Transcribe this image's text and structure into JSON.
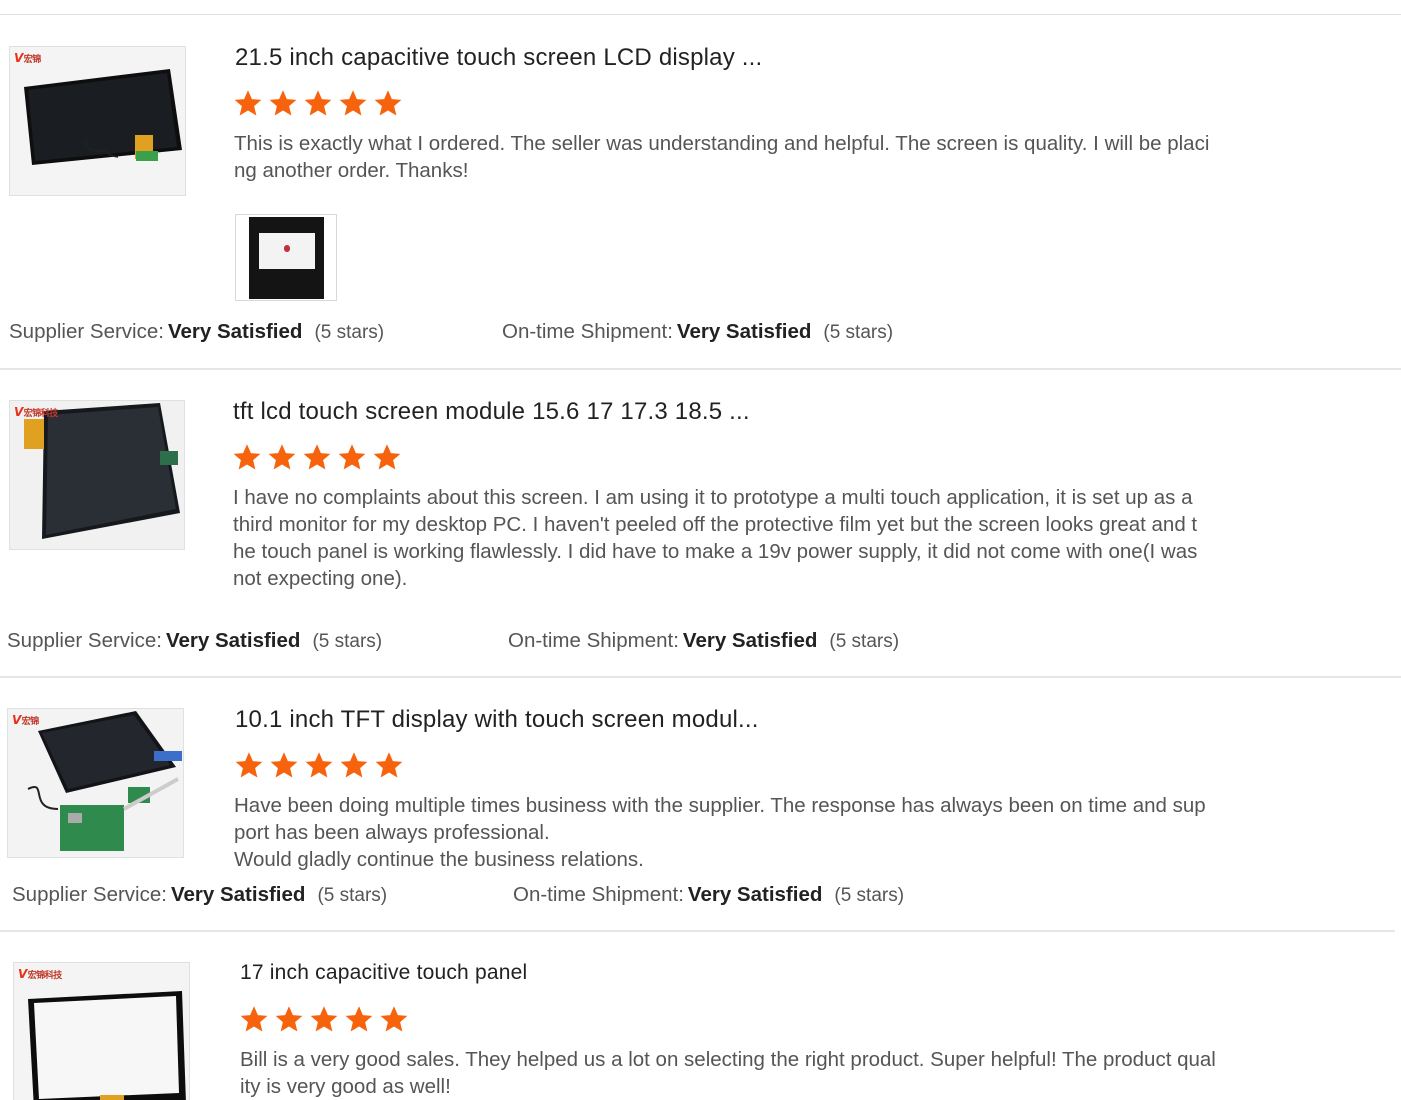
{
  "colors": {
    "star": "#f7630c",
    "divider": "#e6e6e6"
  },
  "reviews": [
    {
      "title": "21.5 inch capacitive touch screen LCD display ...",
      "rating": 5,
      "comment_lines": [
        "This is exactly what I ordered. The seller was understanding and helpful. The screen is quality. I will be placi",
        "ng another order. Thanks!"
      ],
      "supplier_label": "Supplier Service:",
      "supplier_value": "Very Satisfied",
      "supplier_count": "(5 stars)",
      "shipment_label": "On-time Shipment:",
      "shipment_value": "Very Satisfied",
      "shipment_count": "(5 stars)",
      "thumb_icon": "lcd-display-product-image"
    },
    {
      "title": "tft lcd touch screen module 15.6 17 17.3 18.5 ...",
      "rating": 5,
      "comment_lines": [
        "I have no complaints about this screen. I am using it to prototype a multi touch application, it is set up as a",
        "third monitor for my desktop PC. I haven't peeled off the protective film yet but the screen looks great and t",
        "he touch panel is working flawlessly. I did have to make a 19v power supply, it did not come with one(I was",
        "not expecting one)."
      ],
      "supplier_label": "Supplier Service:",
      "supplier_value": "Very Satisfied",
      "supplier_count": "(5 stars)",
      "shipment_label": "On-time Shipment:",
      "shipment_value": "Very Satisfied",
      "shipment_count": "(5 stars)",
      "thumb_icon": "tft-module-product-image"
    },
    {
      "title": "10.1 inch TFT display with touch screen modul...",
      "rating": 5,
      "comment_lines": [
        "Have been doing multiple times business with the supplier. The response has always been on time and sup",
        "port has been always professional.",
        "Would gladly continue the business relations."
      ],
      "supplier_label": "Supplier Service:",
      "supplier_value": "Very Satisfied",
      "supplier_count": "(5 stars)",
      "shipment_label": "On-time Shipment:",
      "shipment_value": "Very Satisfied",
      "shipment_count": "(5 stars)",
      "thumb_icon": "tft-display-board-product-image"
    },
    {
      "title": "17 inch capacitive touch panel",
      "rating": 5,
      "comment_lines": [
        "Bill is a very good sales. They helped us a lot on selecting the right product. Super helpful! The product qual",
        "ity is very good as well!"
      ],
      "thumb_icon": "touch-panel-product-image"
    }
  ]
}
